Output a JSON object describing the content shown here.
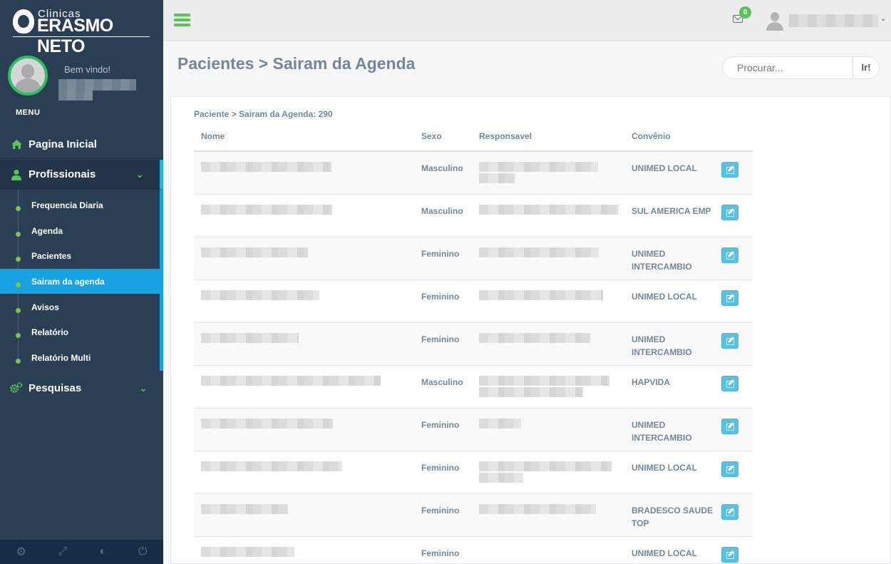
{
  "brand": {
    "small": "Clinicas",
    "big": "ERASMO NETO"
  },
  "profile": {
    "welcome": "Bem vindo!"
  },
  "menu_title": "MENU",
  "nav": {
    "home": "Pagina Inicial",
    "profissionais": "Profissionais",
    "pesquisas": "Pesquisas",
    "sub": [
      "Frequencia Diaria",
      "Agenda",
      "Pacientes",
      "Sairam da agenda",
      "Avisos",
      "Relatório",
      "Relatório Multi"
    ]
  },
  "topbar": {
    "mail_count": "0"
  },
  "page": {
    "title": "Pacientes > Sairam da Agenda"
  },
  "search": {
    "placeholder": "Procurar...",
    "go": "Ir!"
  },
  "panel": {
    "subtitle": "Paciente > Sairam da Agenda: 290"
  },
  "table": {
    "headers": [
      "Nome",
      "Sexo",
      "Responsavel",
      "Convênio"
    ],
    "rows": [
      {
        "sexo": "Masculino",
        "convenio": "UNIMED LOCAL"
      },
      {
        "sexo": "Masculino",
        "convenio": "SUL AMERICA EMP"
      },
      {
        "sexo": "Feminino",
        "convenio": "UNIMED INTERCAMBIO"
      },
      {
        "sexo": "Feminino",
        "convenio": "UNIMED LOCAL"
      },
      {
        "sexo": "Feminino",
        "convenio": "UNIMED INTERCAMBIO"
      },
      {
        "sexo": "Masculino",
        "convenio": "HAPVIDA"
      },
      {
        "sexo": "Feminino",
        "convenio": "UNIMED INTERCAMBIO"
      },
      {
        "sexo": "Feminino",
        "convenio": "UNIMED LOCAL"
      },
      {
        "sexo": "Feminino",
        "convenio": "BRADESCO SAUDE TOP"
      },
      {
        "sexo": "Feminino",
        "convenio": "UNIMED LOCAL"
      }
    ]
  },
  "icons": {
    "home": "home-icon",
    "profissionais": "user-md-icon",
    "pesquisas": "cogs-icon",
    "footer": [
      "settings-icon",
      "fullscreen-icon",
      "eye-slash-icon",
      "power-icon"
    ]
  }
}
